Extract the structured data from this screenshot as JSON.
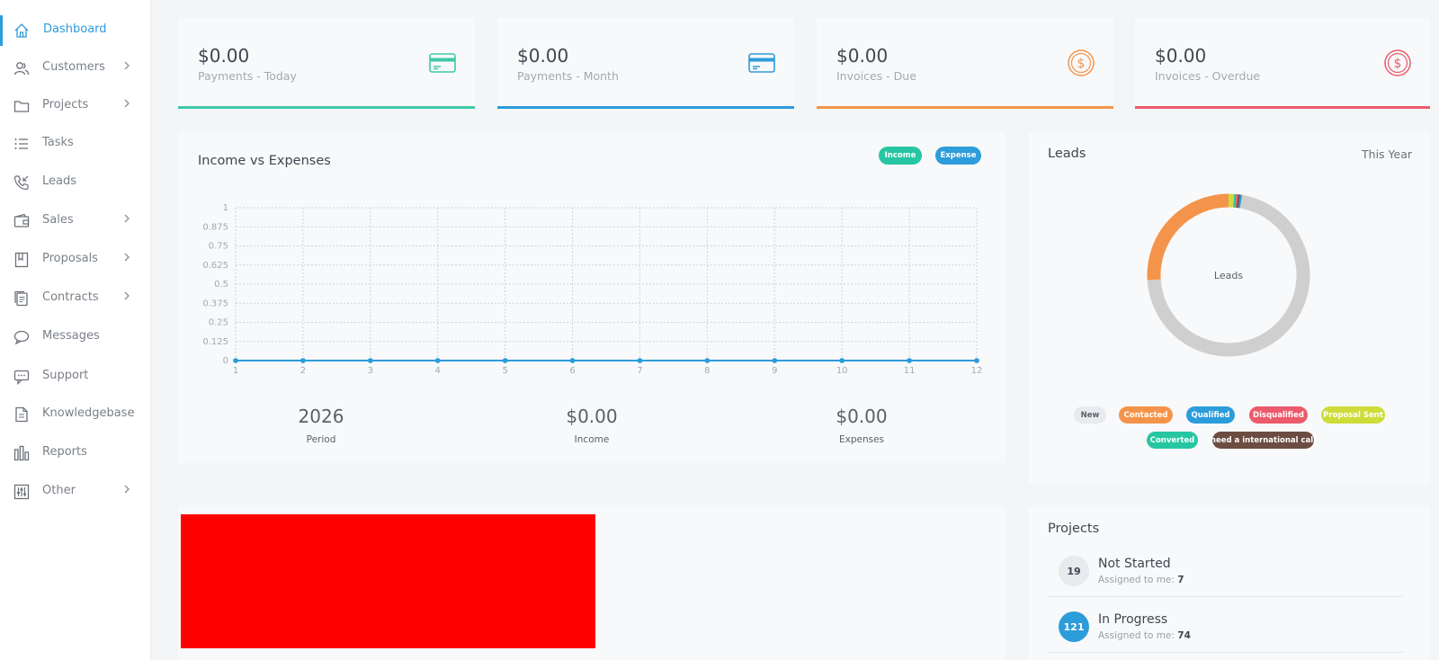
{
  "sidebar": {
    "items": [
      {
        "label": "Dashboard",
        "icon": "home-icon",
        "active": true,
        "chevron": false
      },
      {
        "label": "Customers",
        "icon": "users-icon",
        "chevron": true
      },
      {
        "label": "Projects",
        "icon": "folder-icon",
        "chevron": true
      },
      {
        "label": "Tasks",
        "icon": "list-icon",
        "chevron": false
      },
      {
        "label": "Leads",
        "icon": "phone-icon",
        "chevron": false
      },
      {
        "label": "Sales",
        "icon": "wallet-icon",
        "chevron": true
      },
      {
        "label": "Proposals",
        "icon": "bookmark-icon",
        "chevron": true
      },
      {
        "label": "Contracts",
        "icon": "contract-icon",
        "chevron": true
      },
      {
        "label": "Messages",
        "icon": "chat-icon",
        "chevron": false
      },
      {
        "label": "Support",
        "icon": "support-icon",
        "chevron": false
      },
      {
        "label": "Knowledgebase",
        "icon": "document-icon",
        "chevron": false
      },
      {
        "label": "Reports",
        "icon": "bar-chart-icon",
        "chevron": false
      },
      {
        "label": "Other",
        "icon": "sliders-icon",
        "chevron": true
      }
    ]
  },
  "stats": [
    {
      "amount": "$0.00",
      "label": "Payments - Today",
      "icon": "credit-card-icon",
      "color": "#3ec9a7"
    },
    {
      "amount": "$0.00",
      "label": "Payments - Month",
      "icon": "credit-card-icon",
      "color": "#2d9cdb"
    },
    {
      "amount": "$0.00",
      "label": "Invoices - Due",
      "icon": "dollar-coin-icon",
      "color": "#f4944a"
    },
    {
      "amount": "$0.00",
      "label": "Invoices - Overdue",
      "icon": "dollar-coin-icon",
      "color": "#ec5a6b"
    }
  ],
  "income_chart": {
    "title": "Income vs Expenses",
    "legend": [
      {
        "label": "Income",
        "color": "#26c6a2"
      },
      {
        "label": "Expense",
        "color": "#2d9cdb"
      }
    ],
    "summary": [
      {
        "value": "2026",
        "label": "Period"
      },
      {
        "value": "$0.00",
        "label": "Income"
      },
      {
        "value": "$0.00",
        "label": "Expenses"
      }
    ]
  },
  "chart_data": {
    "type": "line",
    "title": "Income vs Expenses",
    "x": [
      1,
      2,
      3,
      4,
      5,
      6,
      7,
      8,
      9,
      10,
      11,
      12
    ],
    "yticks": [
      "0",
      "0.125",
      "0.25",
      "0.375",
      "0.5",
      "0.625",
      "0.75",
      "0.875",
      "1"
    ],
    "ylim": [
      0,
      1
    ],
    "grid": true,
    "legend_position": "top-right",
    "series": [
      {
        "name": "Income",
        "color": "#26c6a2",
        "values": [
          0,
          0,
          0,
          0,
          0,
          0,
          0,
          0,
          0,
          0,
          0,
          0
        ]
      },
      {
        "name": "Expense",
        "color": "#2d9cdb",
        "values": [
          0,
          0,
          0,
          0,
          0,
          0,
          0,
          0,
          0,
          0,
          0,
          0
        ]
      }
    ]
  },
  "leads": {
    "title": "Leads",
    "period": "This Year",
    "center_label": "Leads",
    "donut": [
      {
        "status": "Contacted",
        "color": "#f4944a",
        "fraction": 0.26
      },
      {
        "status": "Proposal Sent",
        "color": "#cddc39",
        "fraction": 0.011
      },
      {
        "status": "Converted",
        "color": "#26c6a2",
        "fraction": 0.004
      },
      {
        "status": "Disqualified",
        "color": "#ec5a6b",
        "fraction": 0.004
      },
      {
        "status": "need a international call",
        "color": "#6d4c41",
        "fraction": 0.004
      },
      {
        "status": "Qualified",
        "color": "#2d9cdb",
        "fraction": 0.004
      },
      {
        "status": "New",
        "color": "#cfcfcf",
        "fraction": 0.713
      }
    ],
    "legend": [
      {
        "label": "New",
        "color": "#e8eaed",
        "text_color": "#5a6069"
      },
      {
        "label": "Contacted",
        "color": "#f4944a",
        "text_color": "#ffffff"
      },
      {
        "label": "Qualified",
        "color": "#2d9cdb",
        "text_color": "#ffffff"
      },
      {
        "label": "Disqualified",
        "color": "#ec5a6b",
        "text_color": "#ffffff"
      },
      {
        "label": "Proposal Sent",
        "color": "#cddc39",
        "text_color": "#ffffff"
      },
      {
        "label": "Converted",
        "color": "#26c6a2",
        "text_color": "#ffffff"
      },
      {
        "label": "need a international call",
        "color": "#6d4c41",
        "text_color": "#ffffff"
      }
    ]
  },
  "projects": {
    "title": "Projects",
    "rows": [
      {
        "count": "19",
        "name": "Not Started",
        "assigned_label": "Assigned to me:",
        "assigned": "7",
        "color": "#e8eaed",
        "text_color": "#3f4650"
      },
      {
        "count": "121",
        "name": "In Progress",
        "assigned_label": "Assigned to me:",
        "assigned": "74",
        "color": "#2d9cdb",
        "text_color": "#ffffff"
      }
    ]
  }
}
